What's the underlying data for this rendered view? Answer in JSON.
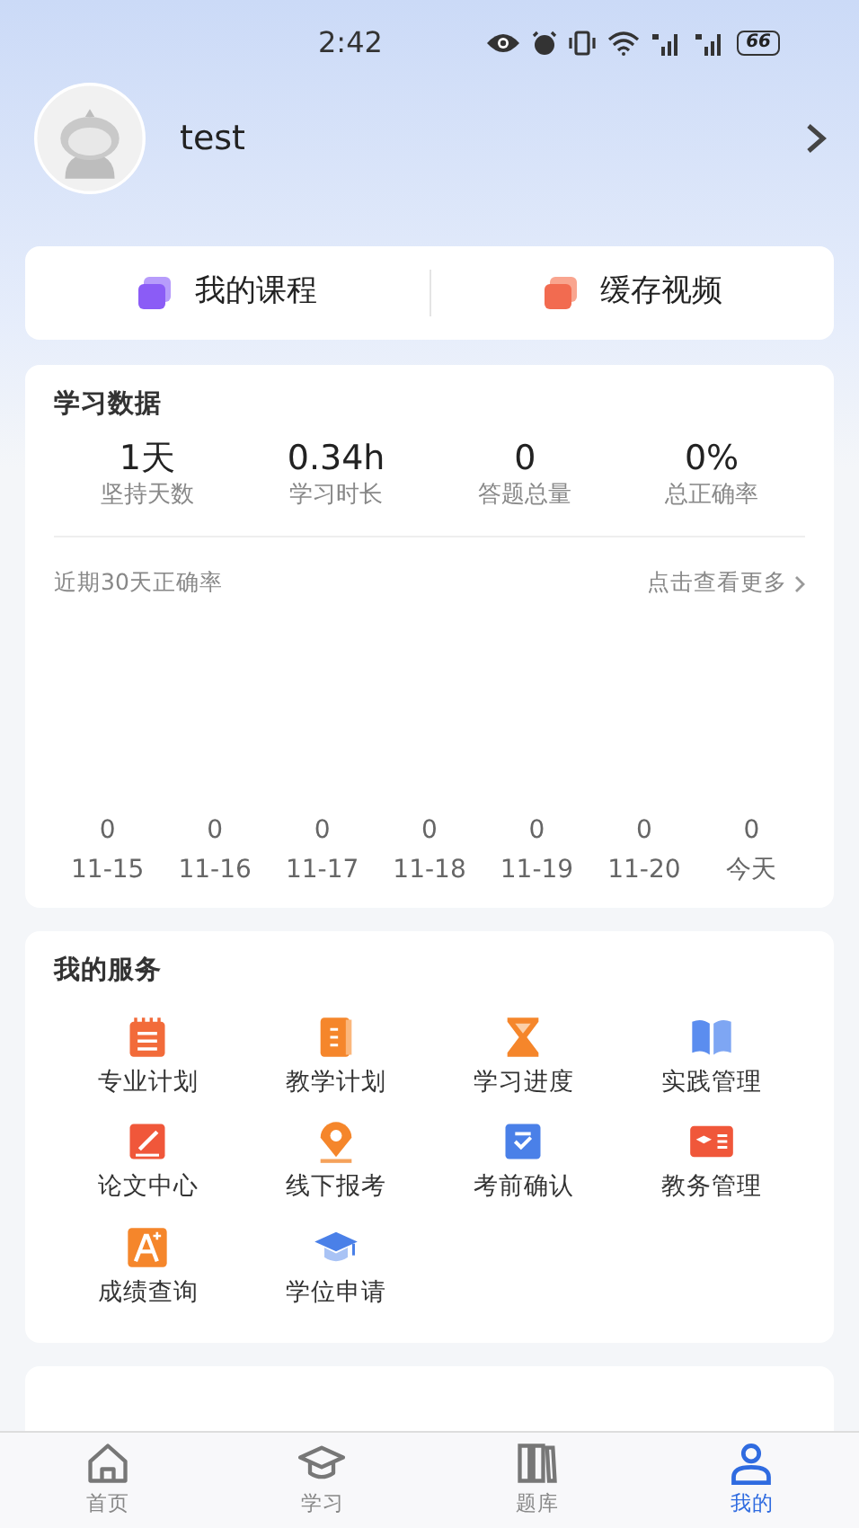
{
  "status_bar": {
    "time": "2:42",
    "battery": "66"
  },
  "profile": {
    "username": "test"
  },
  "quick_links": [
    {
      "label": "我的课程"
    },
    {
      "label": "缓存视频"
    }
  ],
  "study_data": {
    "title": "学习数据",
    "stats": [
      {
        "value": "1天",
        "label": "坚持天数"
      },
      {
        "value": "0.34h",
        "label": "学习时长"
      },
      {
        "value": "0",
        "label": "答题总量"
      },
      {
        "value": "0%",
        "label": "总正确率"
      }
    ],
    "trend_title": "近期30天正确率",
    "more_link": "点击查看更多",
    "trend": [
      {
        "value": "0",
        "date": "11-15"
      },
      {
        "value": "0",
        "date": "11-16"
      },
      {
        "value": "0",
        "date": "11-17"
      },
      {
        "value": "0",
        "date": "11-18"
      },
      {
        "value": "0",
        "date": "11-19"
      },
      {
        "value": "0",
        "date": "11-20"
      },
      {
        "value": "0",
        "date": "今天"
      }
    ]
  },
  "services": {
    "title": "我的服务",
    "items": [
      {
        "label": "专业计划"
      },
      {
        "label": "教学计划"
      },
      {
        "label": "学习进度"
      },
      {
        "label": "实践管理"
      },
      {
        "label": "论文中心"
      },
      {
        "label": "线下报考"
      },
      {
        "label": "考前确认"
      },
      {
        "label": "教务管理"
      },
      {
        "label": "成绩查询"
      },
      {
        "label": "学位申请"
      }
    ]
  },
  "tab_bar": [
    {
      "label": "首页",
      "selected": false
    },
    {
      "label": "学习",
      "selected": false
    },
    {
      "label": "题库",
      "selected": false
    },
    {
      "label": "我的",
      "selected": true
    }
  ]
}
